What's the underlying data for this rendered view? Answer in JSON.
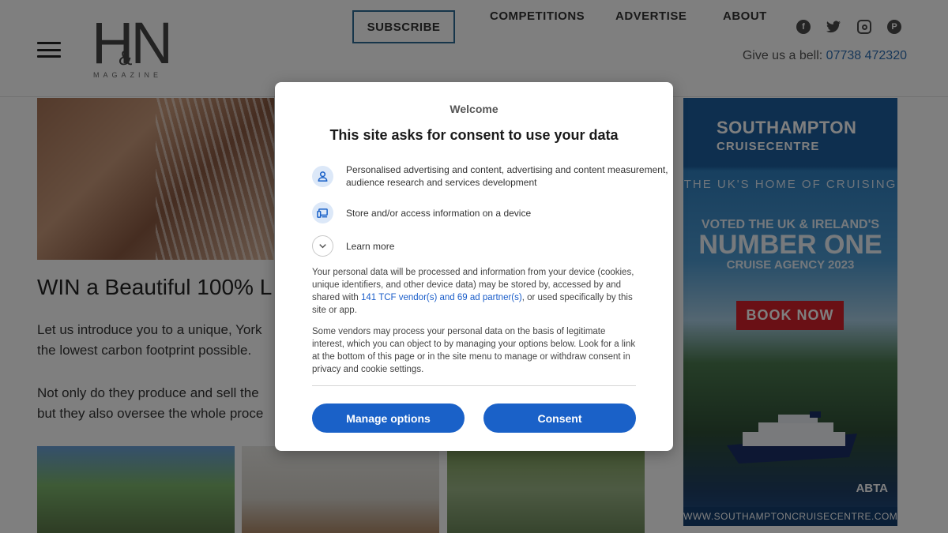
{
  "header": {
    "logo_text": "H&N",
    "logo_subtitle": "MAGAZINE",
    "nav": {
      "subscribe": "SUBSCRIBE",
      "competitions": "COMPETITIONS",
      "advertise": "ADVERTISE",
      "about": "ABOUT"
    },
    "social": [
      "facebook-icon",
      "twitter-icon",
      "instagram-icon",
      "pinterest-icon"
    ],
    "bell_text": "Give us a bell:",
    "phone": "07738 472320"
  },
  "article": {
    "headline": "WIN a Beautiful 100% L",
    "para1_line1": "Let us introduce you to a unique, York",
    "para1_line2": "the lowest carbon footprint possible.",
    "para2_line1": "Not only do they produce and sell the",
    "para2_line2": "but they also oversee the whole proce"
  },
  "ad": {
    "brand_line1": "SOUTHAMPTON",
    "brand_line2": "CRUISECENTRE",
    "tagline": "THE UK'S HOME OF CRUISING",
    "voted": "VOTED THE UK & IRELAND'S",
    "number_one": "NUMBER ONE",
    "agency": "CRUISE AGENCY 2023",
    "book": "BOOK NOW",
    "abta": "ABTA",
    "url": "WWW.SOUTHAMPTONCRUISECENTRE.COM"
  },
  "consent": {
    "welcome": "Welcome",
    "title": "This site asks for consent to use your data",
    "purpose1": "Personalised advertising and content, advertising and content measurement, audience research and services development",
    "purpose2": "Store and/or access information on a device",
    "learn_more": "Learn more",
    "body1_pre": "Your personal data will be processed and information from your device (cookies, unique identifiers, and other device data) may be stored by, accessed by and shared with ",
    "body1_link": "141 TCF vendor(s) and 69 ad partner(s)",
    "body1_post": ", or used specifically by this site or app.",
    "body2": "Some vendors may process your personal data on the basis of legitimate interest, which you can object to by managing your options below. Look for a link at the bottom of this page or in the site menu to manage or withdraw consent in privacy and cookie settings.",
    "manage_button": "Manage options",
    "consent_button": "Consent"
  },
  "colors": {
    "accent_blue": "#1a61c8",
    "link_blue": "#2f6fb3",
    "ad_red": "#d4202a"
  }
}
